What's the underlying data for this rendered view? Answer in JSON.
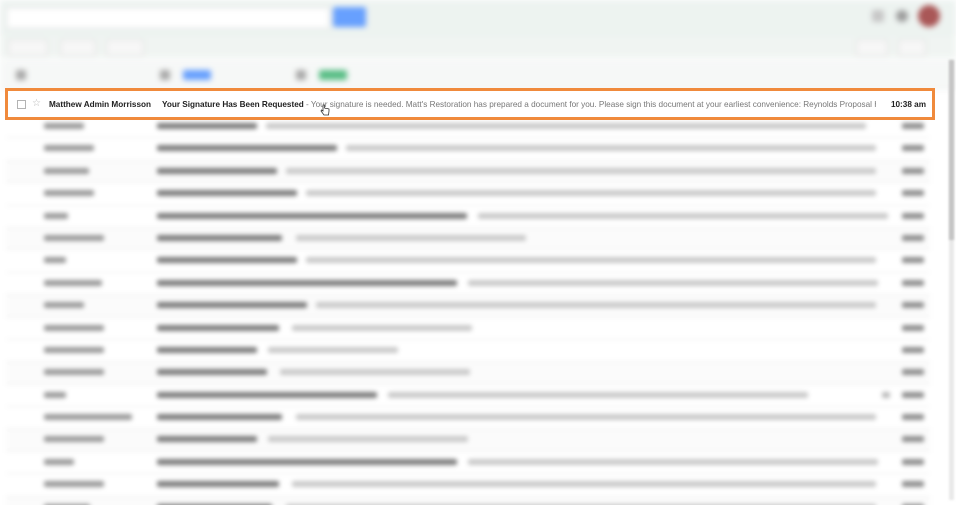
{
  "search": {
    "placeholder": ""
  },
  "highlighted_email": {
    "sender": "Matthew Admin Morrisson",
    "subject": "Your Signature Has Been Requested",
    "snippet": " - Your signature is needed. Matt's Restoration has prepared a document for you. Please sign this document at your earliest convenience: Reynolds Proposal Here's the proposal I promised you",
    "time": "10:38 am",
    "highlight_color": "#f08a3c"
  },
  "icons": {
    "checkbox": "checkbox-icon",
    "star": "star-icon",
    "cursor": "hand-cursor-icon",
    "apps": "apps-grid-icon",
    "notifications": "bell-icon"
  },
  "colors": {
    "accent": "#4d90fe",
    "header_bg": "#eaf1ee",
    "avatar": "#9b3a3a"
  }
}
